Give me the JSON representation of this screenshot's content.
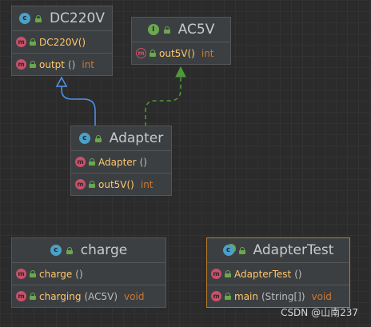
{
  "classes": {
    "dc220v": {
      "title": "DC220V",
      "kind": "class",
      "methods": [
        {
          "name": "DC220V()",
          "params": "",
          "ret": ""
        },
        {
          "name": "outpt",
          "params": "()",
          "ret": "int"
        }
      ]
    },
    "ac5v": {
      "title": "AC5V",
      "kind": "interface",
      "methods": [
        {
          "name": "out5V()",
          "params": "",
          "ret": "int"
        }
      ]
    },
    "adapter": {
      "title": "Adapter",
      "kind": "class",
      "methods": [
        {
          "name": "Adapter",
          "params": "()",
          "ret": ""
        },
        {
          "name": "out5V()",
          "params": "",
          "ret": "int"
        }
      ]
    },
    "charge": {
      "title": "charge",
      "kind": "class",
      "methods": [
        {
          "name": "charge",
          "params": "()",
          "ret": ""
        },
        {
          "name": "charging",
          "params": "(AC5V)",
          "ret": "void"
        }
      ]
    },
    "adaptertest": {
      "title": "AdapterTest",
      "kind": "class",
      "methods": [
        {
          "name": "AdapterTest",
          "params": "()",
          "ret": ""
        },
        {
          "name": "main",
          "params": "(String[])",
          "ret": "void"
        }
      ]
    }
  },
  "relations": [
    {
      "from": "Adapter",
      "to": "DC220V",
      "type": "extends"
    },
    {
      "from": "Adapter",
      "to": "AC5V",
      "type": "implements"
    }
  ],
  "colors": {
    "background": "#2b2b2b",
    "class_badge": "#4aa0c8",
    "interface_badge": "#6aa84f",
    "method_badge": "#c9506a",
    "method_name": "#ffc66d",
    "return_type": "#cc7832",
    "extends_arrow": "#5394ec",
    "implements_arrow": "#4e9a3a"
  },
  "watermark": "CSDN @山南237"
}
